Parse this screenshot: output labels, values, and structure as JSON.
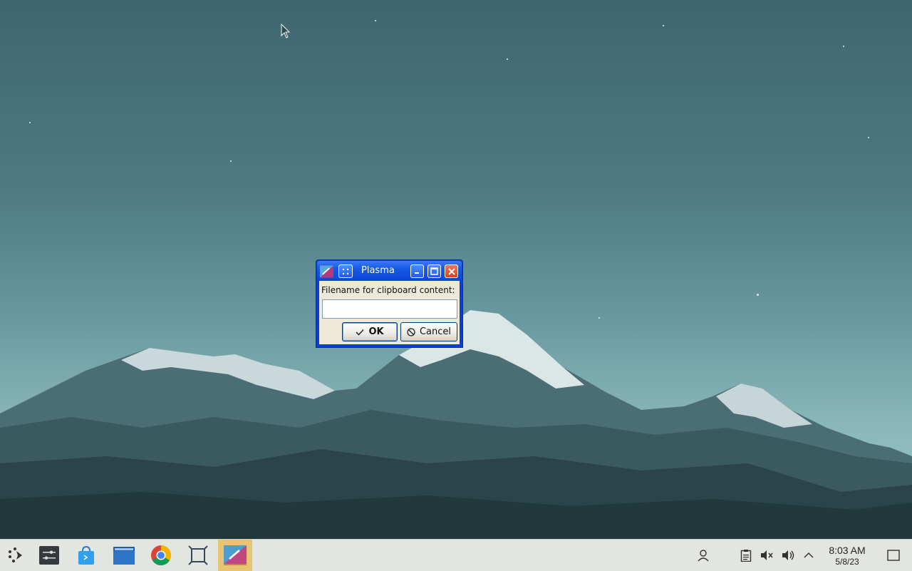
{
  "dialog": {
    "title": "Plasma",
    "prompt_label": "Filename for clipboard content:",
    "input_value": "",
    "input_placeholder": "",
    "ok_label": "OK",
    "cancel_label": "Cancel"
  },
  "taskbar": {
    "apps": [
      {
        "name": "application-launcher",
        "icon": "launcher-icon"
      },
      {
        "name": "system-settings",
        "icon": "settings-icon"
      },
      {
        "name": "discover-store",
        "icon": "store-bag-icon"
      },
      {
        "name": "file-manager",
        "icon": "folder-icon"
      },
      {
        "name": "chrome-browser",
        "icon": "chrome-icon"
      },
      {
        "name": "screenshot-tool",
        "icon": "screenshot-icon"
      },
      {
        "name": "plasma-active",
        "icon": "plasma-icon"
      }
    ],
    "tray": [
      "user-icon",
      "clipboard-icon",
      "mute-icon",
      "volume-icon",
      "chevron-up-icon"
    ],
    "clock": {
      "time": "8:03 AM",
      "date": "5/8/23"
    }
  },
  "colors": {
    "dialog_frame": "#0a3fd6",
    "dialog_body": "#ece9d8",
    "taskbar": "#e3e5e1",
    "active_task": "#e8c574"
  }
}
